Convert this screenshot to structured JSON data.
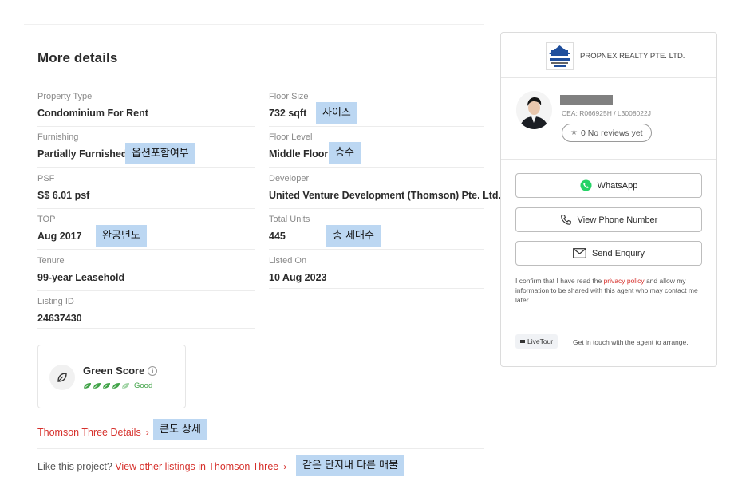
{
  "section_title": "More details",
  "details": [
    {
      "label": "Property Type",
      "value": "Condominium For Rent"
    },
    {
      "label": "Floor Size",
      "value": "732 sqft"
    },
    {
      "label": "Furnishing",
      "value": "Partially Furnished"
    },
    {
      "label": "Floor Level",
      "value": "Middle Floor"
    },
    {
      "label": "PSF",
      "value": "S$ 6.01 psf"
    },
    {
      "label": "Developer",
      "value": "United Venture Development (Thomson) Pte. Ltd."
    },
    {
      "label": "TOP",
      "value": "Aug 2017"
    },
    {
      "label": "Total Units",
      "value": "445"
    },
    {
      "label": "Tenure",
      "value": "99-year Leasehold"
    },
    {
      "label": "Listed On",
      "value": "10 Aug 2023"
    },
    {
      "label": "Listing ID",
      "value": "24637430"
    }
  ],
  "annotations": {
    "floor_size": "사이즈",
    "furnishing": "옵션포함여부",
    "floor_level": "층수",
    "top": "완공년도",
    "total_units": "총 세대수",
    "project_details": "콘도 상세",
    "other_listings": "같은 단지내 다른 매물"
  },
  "green_score": {
    "title": "Green Score",
    "info_glyph": "i",
    "rating_text": "Good",
    "leaves_filled": 4,
    "leaves_total": 5,
    "leaf_color": "#3fa246"
  },
  "project_link": {
    "label": "Thomson Three Details",
    "chevron": "›"
  },
  "like_line": {
    "prefix": "Like this project? ",
    "link": "View other listings in Thomson Three",
    "chevron": "›"
  },
  "agent_panel": {
    "agency_name": "PROPNEX REALTY PTE. LTD.",
    "agency_logo_text": "PropNex",
    "cea": "CEA: R066925H / L3008022J",
    "reviews": "0  No reviews yet",
    "buttons": {
      "whatsapp": "WhatsApp",
      "phone": "View Phone Number",
      "enquiry": "Send Enquiry"
    },
    "consent_prefix": "I confirm that I have read the ",
    "consent_link": "privacy policy",
    "consent_suffix": " and allow my information to be shared with this agent who may contact me later.",
    "livetour_label": "LiveTour",
    "livetour_text": "Get in touch with the agent to arrange."
  },
  "colors": {
    "accent_red": "#d6302b",
    "note_bg": "#bcd7f2",
    "whatsapp_green": "#25d366"
  }
}
